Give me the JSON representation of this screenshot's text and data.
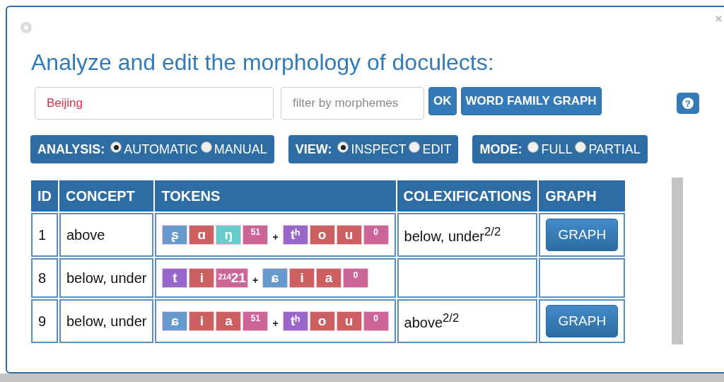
{
  "title": "Analyze and edit the morphology of doculects:",
  "doculect_field": {
    "value": "Beijing"
  },
  "filter_field": {
    "placeholder": "filter by morphemes"
  },
  "buttons": [
    {
      "label": "OK"
    },
    {
      "label": "WORD FAMILY GRAPH"
    }
  ],
  "help_button": {
    "label": "?"
  },
  "option_groups": [
    {
      "label": "ANALYSIS:",
      "options": [
        {
          "label": "AUTOMATIC",
          "selected": true
        },
        {
          "label": "MANUAL",
          "selected": false
        }
      ]
    },
    {
      "label": "VIEW:",
      "options": [
        {
          "label": "INSPECT",
          "selected": true
        },
        {
          "label": "EDIT",
          "selected": false
        }
      ]
    },
    {
      "label": "MODE:",
      "options": [
        {
          "label": "FULL",
          "selected": false
        },
        {
          "label": "PARTIAL",
          "selected": false
        }
      ]
    }
  ],
  "table": {
    "columns": [
      "ID",
      "CONCEPT",
      "TOKENS",
      "COLEXIFICATIONS",
      "GRAPH"
    ],
    "rows": [
      {
        "id": "1",
        "concept": "above",
        "tokens": [
          {
            "kind": "segment",
            "text": "ʂ",
            "color": "#6699cc"
          },
          {
            "kind": "segment",
            "text": "ɑ",
            "color": "#cc6060"
          },
          {
            "kind": "segment",
            "text": "ŋ",
            "color": "#66cccc"
          },
          {
            "kind": "tone",
            "text": "51",
            "color": "#cc6699"
          },
          {
            "kind": "boundary",
            "text": "+"
          },
          {
            "kind": "segment",
            "text": "tʰ",
            "color": "#9966cc"
          },
          {
            "kind": "segment",
            "text": "o",
            "color": "#cc6060"
          },
          {
            "kind": "segment",
            "text": "u",
            "color": "#cc6060"
          },
          {
            "kind": "tone",
            "text": "0",
            "color": "#cc6699"
          }
        ],
        "colexifications": "below, under$^{2/2}$",
        "graph": "GRAPH"
      },
      {
        "id": "8",
        "concept": "below, under",
        "tokens": [
          {
            "kind": "segment",
            "text": "t",
            "color": "#9966cc"
          },
          {
            "kind": "segment",
            "text": "i",
            "color": "#cc6060"
          },
          {
            "kind": "segment",
            "text": "$^{214}$21",
            "color": "#cc6699"
          },
          {
            "kind": "boundary",
            "text": "+"
          },
          {
            "kind": "segment",
            "text": "ɕ",
            "color": "#6699cc"
          },
          {
            "kind": "segment",
            "text": "i",
            "color": "#cc6060"
          },
          {
            "kind": "segment",
            "text": "a",
            "color": "#cc6060"
          },
          {
            "kind": "tone",
            "text": "0",
            "color": "#cc6699"
          }
        ]
      },
      {
        "id": "9",
        "concept": "below, under",
        "tokens": [
          {
            "kind": "segment",
            "text": "ɕ",
            "color": "#6699cc"
          },
          {
            "kind": "segment",
            "text": "i",
            "color": "#cc6060"
          },
          {
            "kind": "segment",
            "text": "a",
            "color": "#cc6060"
          },
          {
            "kind": "tone",
            "text": "51",
            "color": "#cc6699"
          },
          {
            "kind": "boundary",
            "text": "+"
          },
          {
            "kind": "segment",
            "text": "tʰ",
            "color": "#9966cc"
          },
          {
            "kind": "segment",
            "text": "o",
            "color": "#cc6060"
          },
          {
            "kind": "segment",
            "text": "u",
            "color": "#cc6060"
          },
          {
            "kind": "tone",
            "text": "0",
            "color": "#cc6699"
          }
        ],
        "colexifications": "above$^{2/2}$",
        "graph": "GRAPH"
      }
    ]
  }
}
